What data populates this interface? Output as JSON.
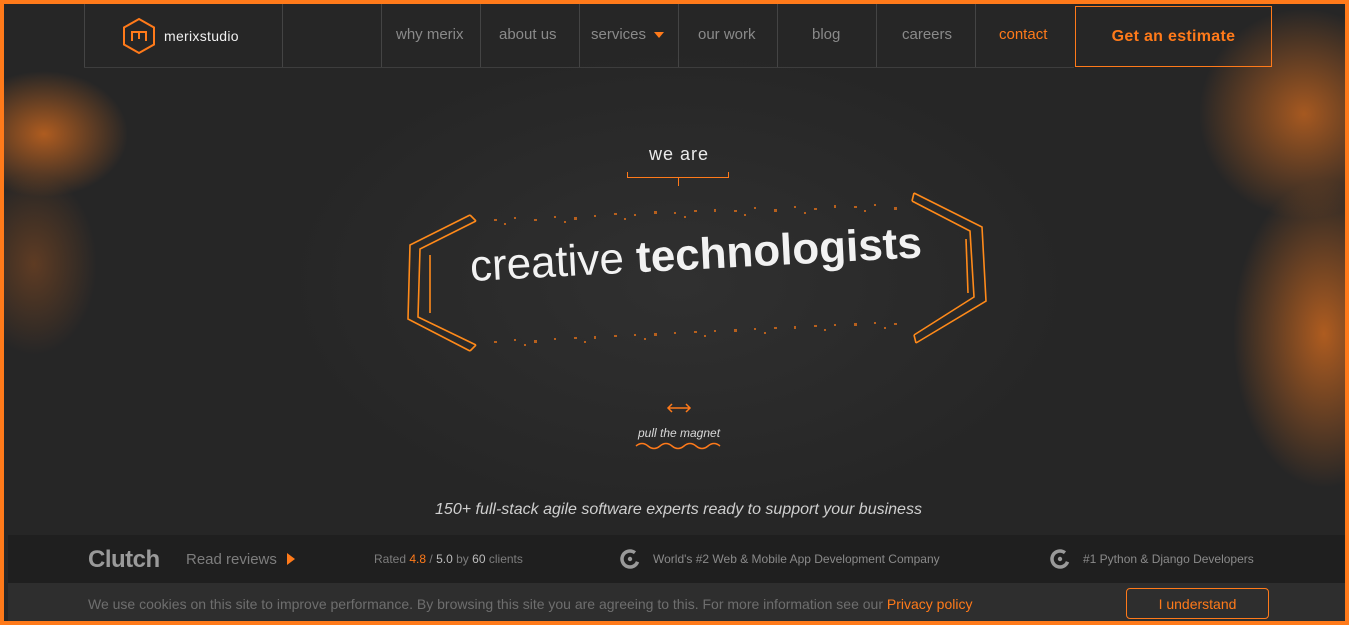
{
  "brand": {
    "name": "merixstudio"
  },
  "nav": {
    "items": [
      {
        "label": "why merix"
      },
      {
        "label": "about us"
      },
      {
        "label": "services"
      },
      {
        "label": "our work"
      },
      {
        "label": "blog"
      },
      {
        "label": "careers"
      },
      {
        "label": "contact"
      }
    ],
    "cta": "Get an estimate"
  },
  "hero": {
    "kicker": "we are",
    "headline_light": "creative",
    "headline_bold": "technologists",
    "pull_hint": "pull the magnet",
    "tagline": "150+ full-stack agile software experts ready to support your business"
  },
  "reviews": {
    "clutch_logo": "Clutch",
    "read_reviews": "Read reviews",
    "rated_prefix": "Rated",
    "rating": "4.8",
    "rating_sep": "/",
    "rating_max": "5.0",
    "by": "by",
    "clients_count": "60",
    "clients_label": "clients",
    "award_1": "World's #2 Web & Mobile App Development Company",
    "award_2": "#1 Python & Django Developers"
  },
  "cookie": {
    "text": "We use cookies on this site to improve performance. By browsing this site you are agreeing to this. For more information see our",
    "link": "Privacy policy",
    "button": "I understand"
  },
  "colors": {
    "accent": "#ff7a1a",
    "background": "#2a2a2a"
  },
  "icons": [
    "logo-hexagon-icon",
    "caret-down-icon",
    "double-arrow-icon",
    "play-arrow-icon",
    "clutch-c-icon"
  ]
}
